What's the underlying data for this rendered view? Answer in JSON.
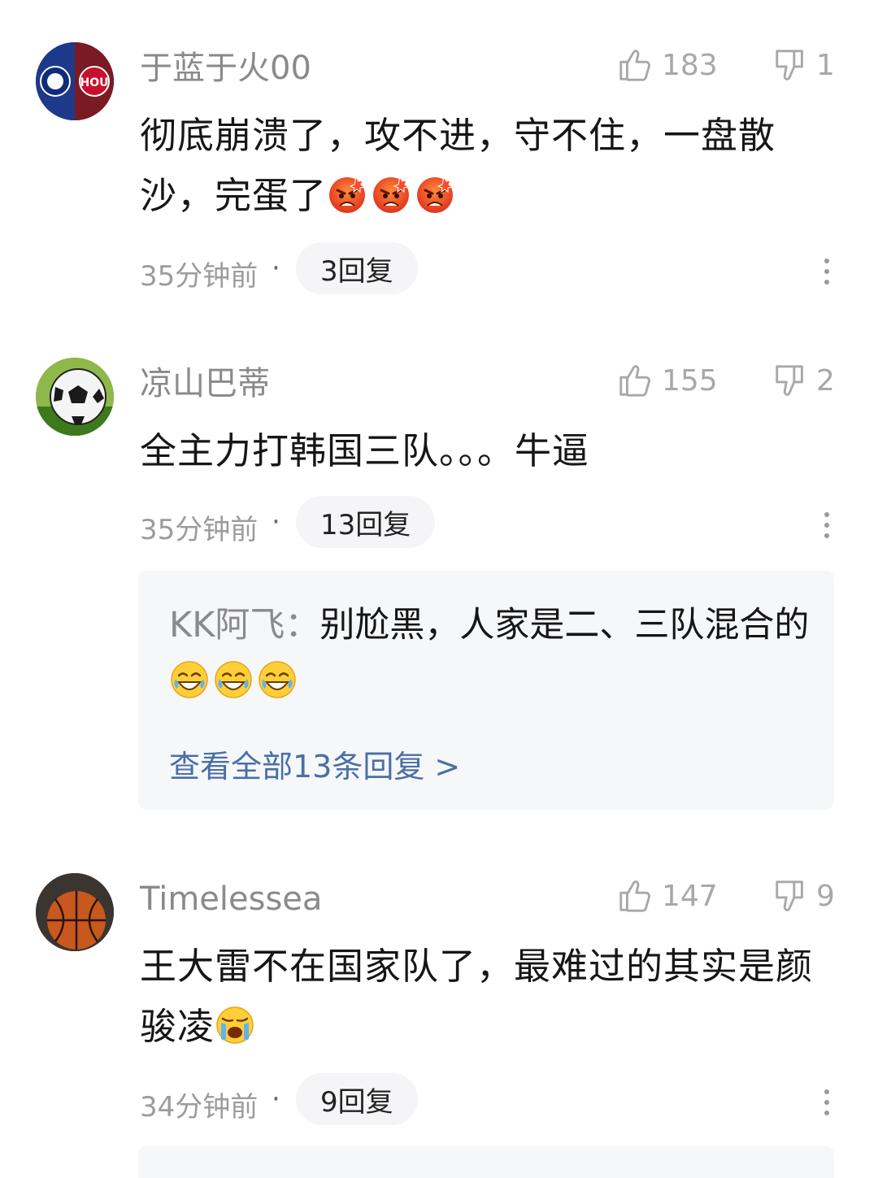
{
  "comments": [
    {
      "username": "于蓝于火00",
      "likes": "183",
      "dislikes": "1",
      "text": "彻底崩溃了，攻不进，守不住，一盘散沙，完蛋了",
      "emojis": [
        "angry-face-emoji",
        "angry-face-emoji",
        "angry-face-emoji"
      ],
      "time": "35分钟前",
      "dot": "·",
      "reply_count": "3回复",
      "avatar": "chelsea-hou-badge-avatar"
    },
    {
      "username": "凉山巴蒂",
      "likes": "155",
      "dislikes": "2",
      "text": "全主力打韩国三队。。。牛逼",
      "time": "35分钟前",
      "dot": "·",
      "reply_count": "13回复",
      "avatar": "soccer-ball-avatar",
      "featured_reply": {
        "name": "KK阿飞：",
        "text": "别尬黑，人家是二、三队混合的",
        "emojis": [
          "tears-of-joy-emoji",
          "tears-of-joy-emoji",
          "tears-of-joy-emoji"
        ],
        "view_all": "查看全部13条回复 >"
      }
    },
    {
      "username": "Timelessea",
      "likes": "147",
      "dislikes": "9",
      "text": "王大雷不在国家队了，最难过的其实是颜骏凌",
      "emojis": [
        "crying-face-emoji"
      ],
      "time": "34分钟前",
      "dot": "·",
      "reply_count": "9回复",
      "avatar": "basketball-avatar"
    }
  ],
  "colors": {
    "username": "#8a8a8a",
    "stat": "#a8a8a8",
    "link": "#4a6fa5",
    "reply_bg": "#f6f7f9"
  }
}
